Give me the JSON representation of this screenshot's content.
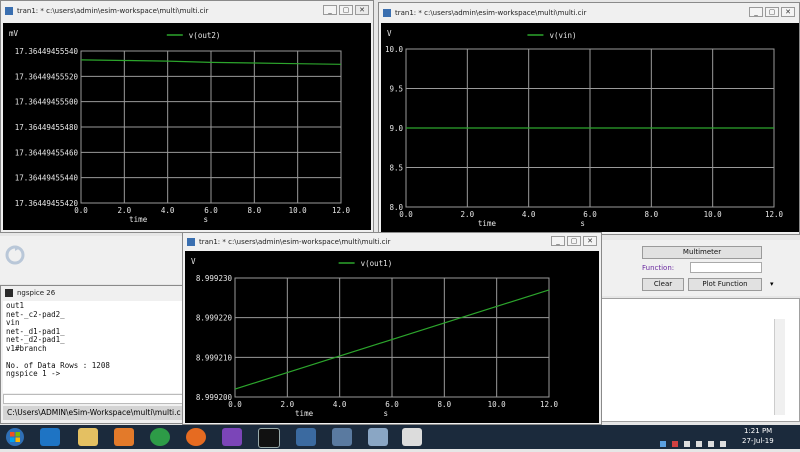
{
  "window1": {
    "title": "tran1: * c:\\users\\admin\\esim-workspace\\multi\\multi.cir",
    "buttons": [
      "_",
      "▢",
      "✕"
    ],
    "chart_data": {
      "type": "line",
      "ylabel": "mV",
      "xlabel": "time",
      "xunit": "s",
      "legend": "v(out2)",
      "xlim": [
        0.0,
        12.0
      ],
      "ylim": [
        17.3644945542,
        17.3644945554
      ],
      "xticks": [
        "0.0",
        "2.0",
        "4.0",
        "6.0",
        "8.0",
        "10.0",
        "12.0"
      ],
      "yticks": [
        "17.36449455540",
        "17.36449455520",
        "17.36449455500",
        "17.36449455480",
        "17.36449455460",
        "17.36449455440",
        "17.36449455420"
      ],
      "x": [
        0,
        2,
        4,
        6,
        8,
        10,
        12
      ],
      "y": [
        17.36449455533,
        17.364494555325,
        17.36449455532,
        17.36449455531,
        17.364494555305,
        17.3644945553,
        17.364494555295
      ],
      "color": "#2ca52c"
    }
  },
  "window2": {
    "title": "tran1: * c:\\users\\admin\\esim-workspace\\multi\\multi.cir",
    "buttons": [
      "_",
      "▢",
      "✕"
    ],
    "chart_data": {
      "type": "line",
      "ylabel": "V",
      "xlabel": "time",
      "xunit": "s",
      "legend": "v(vin)",
      "xlim": [
        0.0,
        12.0
      ],
      "ylim": [
        8.0,
        10.0
      ],
      "xticks": [
        "0.0",
        "2.0",
        "4.0",
        "6.0",
        "8.0",
        "10.0",
        "12.0"
      ],
      "yticks": [
        "10.0",
        "9.5",
        "9.0",
        "8.5",
        "8.0"
      ],
      "x": [
        0,
        12
      ],
      "y": [
        9.0,
        9.0
      ],
      "color": "#2ca52c"
    }
  },
  "window3": {
    "title": "tran1: * c:\\users\\admin\\esim-workspace\\multi\\multi.cir",
    "buttons": [
      "_",
      "▢",
      "✕"
    ],
    "chart_data": {
      "type": "line",
      "ylabel": "V",
      "xlabel": "time",
      "xunit": "s",
      "legend": "v(out1)",
      "xlim": [
        0.0,
        12.0
      ],
      "ylim": [
        8.9992,
        8.99923
      ],
      "xticks": [
        "0.0",
        "2.0",
        "4.0",
        "6.0",
        "8.0",
        "10.0",
        "12.0"
      ],
      "yticks": [
        "8.999230",
        "8.999220",
        "8.999210",
        "8.999200"
      ],
      "x": [
        0,
        12
      ],
      "y": [
        8.999202,
        8.999227
      ],
      "color": "#2ca52c"
    }
  },
  "ngspice": {
    "title": "ngspice 26",
    "lines": [
      "out1",
      "net-_c2-pad2_",
      "vin",
      "net-_d1-pad1_",
      "net-_d2-pad1_",
      "v1#branch",
      "",
      "No. of Data Rows : 1208",
      "ngspice 1 ->"
    ],
    "path": "C:\\Users\\ADMIN\\eSim-Workspace\\multi\\multi.c"
  },
  "multimeter": {
    "title_button": "Multimeter",
    "function_label": "Function:",
    "clear_button": "Clear",
    "plot_button": "Plot Function"
  },
  "taskbar": {
    "time": "1:21 PM",
    "date": "27-Jul-19"
  }
}
